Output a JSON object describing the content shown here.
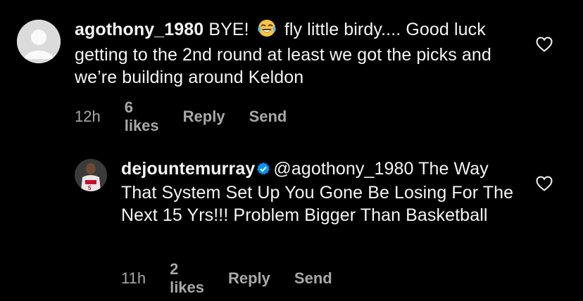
{
  "comments": [
    {
      "username": "agothony_1980",
      "verified": false,
      "text_before_emoji": "BYE! ",
      "emoji": "😂",
      "text_after_emoji": " fly little birdy.... Good luck getting to the 2nd round at least we got the picks and we’re building around Keldon",
      "time": "12h",
      "likes": "6 likes",
      "reply_label": "Reply",
      "send_label": "Send",
      "avatar_icon": "default-profile-icon",
      "like_icon": "heart-outline-icon"
    },
    {
      "username": "dejountemurray",
      "verified": true,
      "mention": "@agothony_1980",
      "text": " The Way That System Set Up You Gone Be Losing For The Next 15 Yrs!!! Problem Bigger Than Basketball",
      "time": "11h",
      "likes": "2 likes",
      "reply_label": "Reply",
      "send_label": "Send",
      "avatar_icon": "profile-photo",
      "verified_icon": "verified-badge-icon",
      "like_icon": "heart-outline-icon"
    }
  ],
  "colors": {
    "background": "#000000",
    "text": "#f5f5f5",
    "meta": "#a8a8a8",
    "verified": "#0095f6"
  }
}
